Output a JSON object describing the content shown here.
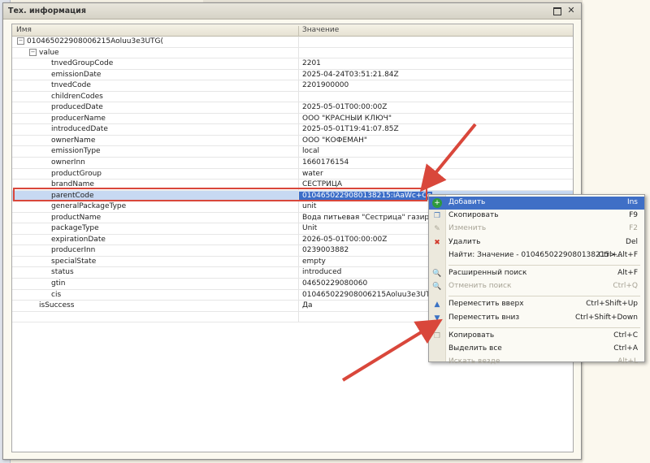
{
  "window": {
    "title": "Тех. информация"
  },
  "columns": {
    "name": "Имя",
    "value": "Значение"
  },
  "rows": [
    {
      "name": "010465022908006215Aoluu3e3UTG(",
      "value": "",
      "level": 0,
      "toggle": "−"
    },
    {
      "name": "value",
      "value": "",
      "level": 1,
      "toggle": "−"
    },
    {
      "name": "tnvedGroupCode",
      "value": "2201",
      "level": 2
    },
    {
      "name": "emissionDate",
      "value": "2025-04-24T03:51:21.84Z",
      "level": 2
    },
    {
      "name": "tnvedCode",
      "value": "2201900000",
      "level": 2
    },
    {
      "name": "childrenCodes",
      "value": "",
      "level": 2
    },
    {
      "name": "producedDate",
      "value": "2025-05-01T00:00:00Z",
      "level": 2
    },
    {
      "name": "producerName",
      "value": "ООО \"КРАСНЫЙ КЛЮЧ\"",
      "level": 2
    },
    {
      "name": "introducedDate",
      "value": "2025-05-01T19:41:07.85Z",
      "level": 2
    },
    {
      "name": "ownerName",
      "value": "ООО \"КОФЕМАН\"",
      "level": 2
    },
    {
      "name": "emissionType",
      "value": "local",
      "level": 2
    },
    {
      "name": "ownerInn",
      "value": "1660176154",
      "level": 2
    },
    {
      "name": "productGroup",
      "value": "water",
      "level": 2
    },
    {
      "name": "brandName",
      "value": "СЕСТРИЦА",
      "level": 2
    },
    {
      "name": "parentCode",
      "value": "0104650229080138215:iAaWc+Cel\"&",
      "level": 2,
      "selected": true
    },
    {
      "name": "generalPackageType",
      "value": "unit",
      "level": 2
    },
    {
      "name": "productName",
      "value": "Вода питьевая \"Сестрица\" газированна",
      "level": 2
    },
    {
      "name": "packageType",
      "value": "Unit",
      "level": 2
    },
    {
      "name": "expirationDate",
      "value": "2026-05-01T00:00:00Z",
      "level": 2
    },
    {
      "name": "producerInn",
      "value": "0239003882",
      "level": 2
    },
    {
      "name": "specialState",
      "value": "empty",
      "level": 2
    },
    {
      "name": "status",
      "value": "introduced",
      "level": 2
    },
    {
      "name": "gtin",
      "value": "04650229080060",
      "level": 2
    },
    {
      "name": "cis",
      "value": "010465022908006215Aoluu3e3UTG(",
      "level": 2
    },
    {
      "name": "isSuccess",
      "value": "Да",
      "level": 1
    },
    {
      "name": "",
      "value": "",
      "level": 0
    }
  ],
  "context_menu": [
    {
      "label": "Добавить",
      "shortcut": "Ins",
      "icon": "add-icon",
      "glyph": "+",
      "color": "#2e9a3e",
      "state": "highlighted"
    },
    {
      "label": "Скопировать",
      "shortcut": "F9",
      "icon": "copy-item-icon",
      "glyph": "❐",
      "color": "#4a78b8",
      "state": "normal"
    },
    {
      "label": "Изменить",
      "shortcut": "F2",
      "icon": "edit-icon",
      "glyph": "✎",
      "color": "#a9a595",
      "state": "disabled"
    },
    {
      "label": "Удалить",
      "shortcut": "Del",
      "icon": "delete-icon",
      "glyph": "✖",
      "color": "#d23a2c",
      "state": "normal"
    },
    {
      "label": "Найти: Значение - 0104650229080138215>...",
      "shortcut": "Ctrl+Alt+F",
      "icon": "",
      "glyph": "",
      "color": "#000",
      "state": "normal"
    },
    {
      "sep": true
    },
    {
      "label": "Расширенный поиск",
      "shortcut": "Alt+F",
      "icon": "search-icon",
      "glyph": "🔍",
      "color": "#555",
      "state": "normal"
    },
    {
      "label": "Отменить поиск",
      "shortcut": "Ctrl+Q",
      "icon": "cancel-search-icon",
      "glyph": "🔍",
      "color": "#a9a595",
      "state": "disabled"
    },
    {
      "sep": true
    },
    {
      "label": "Переместить вверх",
      "shortcut": "Ctrl+Shift+Up",
      "icon": "arrow-up-icon",
      "glyph": "▲",
      "color": "#3a72c4",
      "state": "normal"
    },
    {
      "label": "Переместить вниз",
      "shortcut": "Ctrl+Shift+Down",
      "icon": "arrow-down-icon",
      "glyph": "▼",
      "color": "#3a72c4",
      "state": "normal"
    },
    {
      "sep": true
    },
    {
      "label": "Копировать",
      "shortcut": "Ctrl+C",
      "icon": "copy-icon",
      "glyph": "❐",
      "color": "#a9a595",
      "state": "normal"
    },
    {
      "label": "Выделить все",
      "shortcut": "Ctrl+A",
      "icon": "",
      "glyph": "",
      "color": "#000",
      "state": "normal"
    },
    {
      "label": "Искать везде",
      "shortcut": "Alt+L",
      "icon": "",
      "glyph": "",
      "color": "#000",
      "state": "disabled"
    }
  ],
  "colors": {
    "annotation": "#d9473b",
    "selection": "#3c6ec8",
    "menu_highlight": "#3f6fc6"
  }
}
